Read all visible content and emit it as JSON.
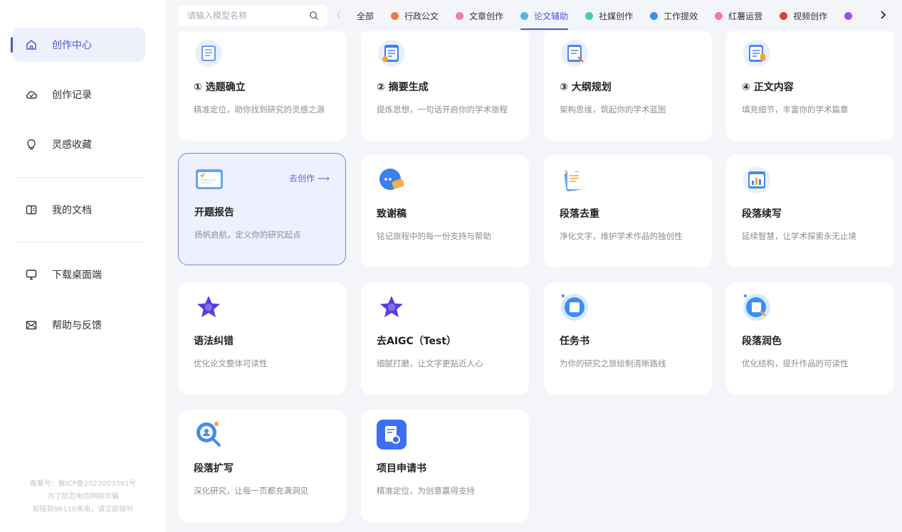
{
  "sidebar": {
    "items": [
      {
        "label": "创作中心",
        "icon": "home-icon",
        "active": true
      },
      {
        "label": "创作记录",
        "icon": "cloud-icon"
      },
      {
        "label": "灵感收藏",
        "icon": "lightbulb-icon"
      },
      {
        "label": "我的文档",
        "icon": "book-icon"
      },
      {
        "label": "下载桌面端",
        "icon": "monitor-icon"
      },
      {
        "label": "帮助与反馈",
        "icon": "mail-icon"
      }
    ],
    "footer": [
      "备案号：冀ICP备2023003391号",
      "为了防范电信网络诈骗",
      "如接到96110来电，请立即接听"
    ]
  },
  "search": {
    "placeholder": "请输入模型名称",
    "value": ""
  },
  "tabs": [
    {
      "label": "全部",
      "color": ""
    },
    {
      "label": "行政公文",
      "color": "#f07a3a"
    },
    {
      "label": "文章创作",
      "color": "#f07ea0"
    },
    {
      "label": "论文辅助",
      "color": "#4fb3ee",
      "active": true
    },
    {
      "label": "社媒创作",
      "color": "#3ed3a3"
    },
    {
      "label": "工作提效",
      "color": "#3e8cf6"
    },
    {
      "label": "红薯运营",
      "color": "#f27a9c"
    },
    {
      "label": "视频创作",
      "color": "#e33a3a"
    },
    {
      "label": "",
      "color": "#9b4ef2"
    }
  ],
  "cards": [
    {
      "title": "① 选题确立",
      "desc": "精准定位，助你找到研究的灵感之源",
      "icon": "list-doc-icon"
    },
    {
      "title": "② 摘要生成",
      "desc": "提炼思想，一句话开启你的学术旅程",
      "icon": "summary-doc-icon"
    },
    {
      "title": "③ 大纲规划",
      "desc": "架构思维，筑起你的学术蓝图",
      "icon": "outline-doc-icon"
    },
    {
      "title": "④ 正文内容",
      "desc": "填充细节，丰富你的学术篇章",
      "icon": "content-doc-icon"
    },
    {
      "title": "开题报告",
      "desc": "扬帆启航，定义你的研究起点",
      "icon": "report-icon",
      "action": "去创作 ⟶"
    },
    {
      "title": "致谢稿",
      "desc": "铭记旅程中的每一份支持与帮助",
      "icon": "chat-icon"
    },
    {
      "title": "段落去重",
      "desc": "净化文字，维护学术作品的独创性",
      "icon": "dedupe-doc-icon"
    },
    {
      "title": "段落续写",
      "desc": "延续智慧，让学术探索永无止境",
      "icon": "chart-doc-icon"
    },
    {
      "title": "语法纠错",
      "desc": "优化论文整体可读性",
      "icon": "star-icon"
    },
    {
      "title": "去AIGC（Test）",
      "desc": "细腻打磨，让文字更贴近人心",
      "icon": "star-icon"
    },
    {
      "title": "任务书",
      "desc": "为你的研究之旅绘制清晰路线",
      "icon": "task-doc-icon"
    },
    {
      "title": "段落润色",
      "desc": "优化结构，提升作品的可读性",
      "icon": "polish-doc-icon"
    },
    {
      "title": "段落扩写",
      "desc": "深化研究，让每一页都充满洞见",
      "icon": "magnifier-icon"
    },
    {
      "title": "项目申请书",
      "desc": "精准定位，为创意赢得支持",
      "icon": "application-doc-icon"
    }
  ],
  "colors": {
    "accent": "#4b57d8",
    "highlight_bg": "#eef0fd",
    "page_bg": "#f4f5f9"
  }
}
